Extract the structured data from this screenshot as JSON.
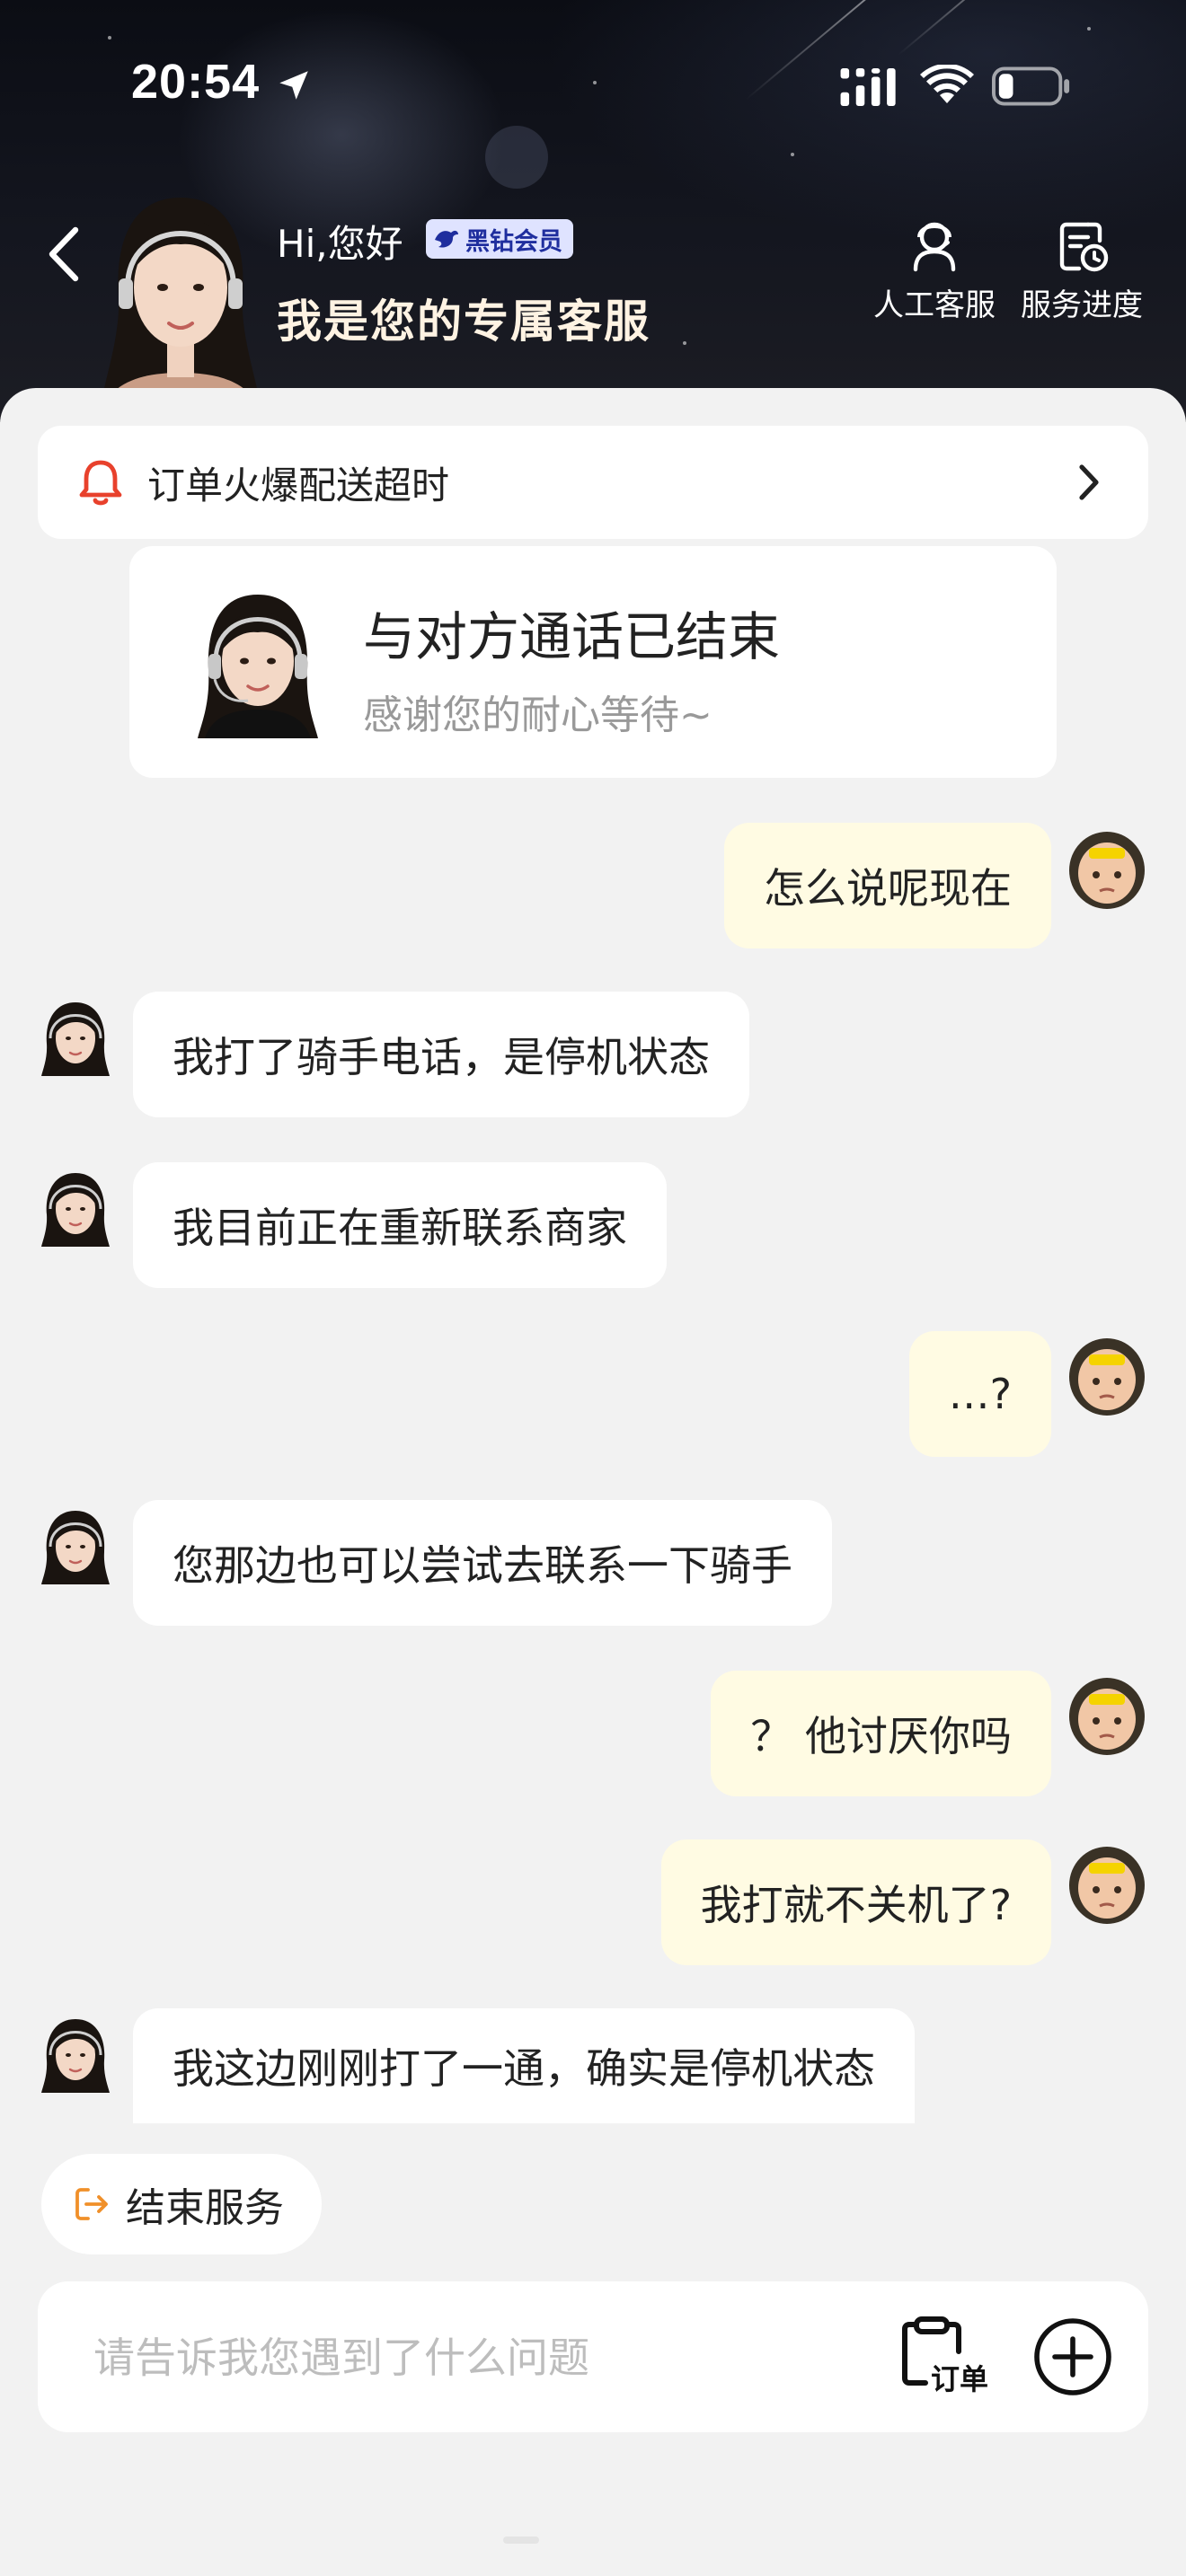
{
  "status_bar": {
    "time": "20:54"
  },
  "header": {
    "greeting": "Hi,您好",
    "vip_badge": "黑钻会员",
    "title": "我是您的专属客服",
    "actions": [
      {
        "label": "人工客服",
        "icon": "headset-agent-icon"
      },
      {
        "label": "服务进度",
        "icon": "service-progress-icon"
      }
    ]
  },
  "notice": {
    "text": "订单火爆配送超时"
  },
  "call_card": {
    "title": "与对方通话已结束",
    "subtitle": "感谢您的耐心等待~"
  },
  "messages": [
    {
      "from": "user",
      "text": "怎么说呢现在"
    },
    {
      "from": "agent",
      "text": "我打了骑手电话，是停机状态"
    },
    {
      "from": "agent",
      "text": "我目前正在重新联系商家"
    },
    {
      "from": "user",
      "text": "…?"
    },
    {
      "from": "agent",
      "text": "您那边也可以尝试去联系一下骑手"
    },
    {
      "from": "user",
      "text": "？ 他讨厌你吗"
    },
    {
      "from": "user",
      "text": "我打就不关机了?"
    },
    {
      "from": "agent",
      "text": "我这边刚刚打了一通，确实是停机状态"
    }
  ],
  "end_service": {
    "label": "结束服务"
  },
  "composer": {
    "placeholder": "请告诉我您遇到了什么问题",
    "order_label": "订单"
  },
  "colors": {
    "user_bubble": "#fffbe3",
    "agent_bubble": "#ffffff",
    "accent_orange": "#f0902a",
    "bell_red": "#e8412c",
    "vip_badge_bg": "#dfe3ff",
    "vip_badge_text": "#1f2e9e"
  }
}
